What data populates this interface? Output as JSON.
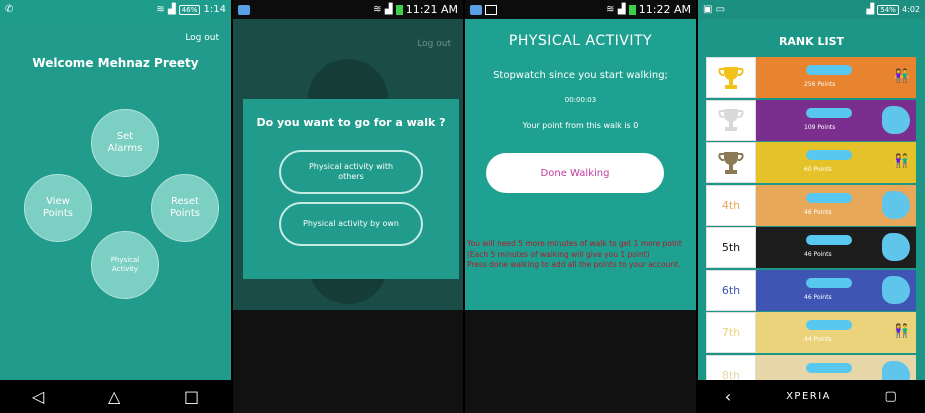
{
  "panel1": {
    "status": {
      "battery": "46%",
      "time": "1:14"
    },
    "logout": "Log out",
    "welcome": "Welcome Mehnaz Preety",
    "circles": {
      "alarms": "Set\nAlarms",
      "view": "View\nPoints",
      "reset": "Reset\nPoints",
      "activity": "Physical\nActivity"
    },
    "nav": {
      "back": "◁",
      "home": "△",
      "recent": "□"
    }
  },
  "panel2": {
    "status": {
      "time": "11:21 AM"
    },
    "logout": "Log out",
    "dialog": {
      "title": "Do you want to go for a walk ?",
      "option1": "Physical activity with others",
      "option2": "Physical activity by own"
    }
  },
  "panel3": {
    "status": {
      "time": "11:22 AM"
    },
    "title": "PHYSICAL ACTIVITY",
    "stopwatch_label": "Stopwatch since you start walking;",
    "stopwatch_time": "00:00:03",
    "walk_points": "Your point from this walk is 0",
    "done_button": "Done Walking",
    "notes": [
      "You will need 5 more minutes of walk to get 1 more point",
      "(Each 5 minutes of walking will give you 1 point)",
      "Press done walking to add all the points to your account."
    ]
  },
  "panel4": {
    "status": {
      "battery": "54%",
      "time": "4:02"
    },
    "title": "RANK LIST",
    "rows": [
      {
        "rank": "",
        "points": "256 Points",
        "bar": "#e8832f",
        "trophy": "gold"
      },
      {
        "rank": "",
        "points": "109 Points",
        "bar": "#7a2f8f",
        "trophy": "silver"
      },
      {
        "rank": "",
        "points": "60 Points",
        "bar": "#e6c22a",
        "trophy": "bronze"
      },
      {
        "rank": "4th",
        "points": "46 Points",
        "bar": "#e8a85a",
        "color": "#e8a85a"
      },
      {
        "rank": "5th",
        "points": "46 Points",
        "bar": "#1d1d1d",
        "color": "#111111"
      },
      {
        "rank": "6th",
        "points": "46 Points",
        "bar": "#3f55b4",
        "color": "#3f55b4"
      },
      {
        "rank": "7th",
        "points": "44 Points",
        "bar": "#ead37a",
        "color": "#ead37a"
      },
      {
        "rank": "8th",
        "points": "",
        "bar": "#e6d6a8",
        "color": "#e6d6a8"
      }
    ],
    "nav": {
      "back": "‹",
      "brand": "XPERIA",
      "recent": "▢"
    }
  }
}
